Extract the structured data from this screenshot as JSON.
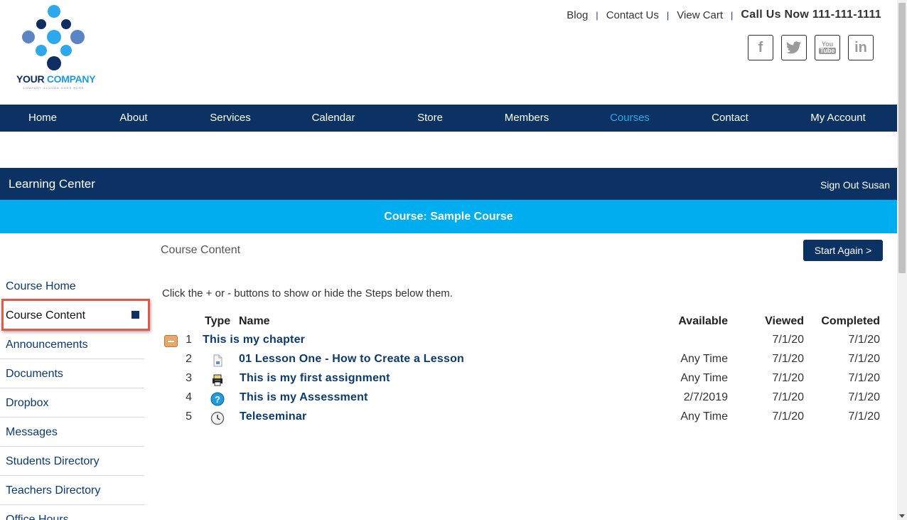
{
  "logo": {
    "text_a": "YOUR ",
    "text_b": "COMPANY",
    "slogan": "COMPANY SLOGAN GOES HERE"
  },
  "toplinks": {
    "blog": "Blog",
    "contact": "Contact Us",
    "cart": "View Cart",
    "call": "Call Us Now 111-111-1111",
    "separator": "|"
  },
  "social": {
    "facebook": "f",
    "twitter": "t",
    "youtube_top": "You",
    "youtube_bottom": "Tube",
    "linkedin": "in"
  },
  "nav": [
    {
      "label": "Home"
    },
    {
      "label": "About"
    },
    {
      "label": "Services"
    },
    {
      "label": "Calendar"
    },
    {
      "label": "Store"
    },
    {
      "label": "Members"
    },
    {
      "label": "Courses",
      "active": true
    },
    {
      "label": "Contact"
    },
    {
      "label": "My Account"
    }
  ],
  "learning_center": {
    "title": "Learning Center",
    "signout": "Sign Out Susan"
  },
  "course_bar": {
    "title": "Course: Sample Course"
  },
  "sidebar": [
    {
      "label": "Course Home"
    },
    {
      "label": "Course Content",
      "active": true
    },
    {
      "label": "Announcements"
    },
    {
      "label": "Documents"
    },
    {
      "label": "Dropbox"
    },
    {
      "label": "Messages"
    },
    {
      "label": "Students Directory"
    },
    {
      "label": "Teachers Directory"
    },
    {
      "label": "Office Hours"
    }
  ],
  "main": {
    "page_label": "Course Content",
    "start_button": "Start Again >",
    "instructions": "Click the + or - buttons to show or hide the Steps below them.",
    "headers": {
      "type": "Type",
      "name": "Name",
      "available": "Available",
      "viewed": "Viewed",
      "completed": "Completed"
    },
    "rows": [
      {
        "num": "1",
        "name": "This is my chapter",
        "available": "",
        "viewed": "7/1/20",
        "completed": "7/1/20",
        "icon": "collapse-icon"
      },
      {
        "num": "2",
        "name": "01 Lesson One - How to Create a Lesson",
        "available": "Any Time",
        "viewed": "7/1/20",
        "completed": "7/1/20",
        "icon": "document-icon"
      },
      {
        "num": "3",
        "name": "This is my first assignment",
        "available": "Any Time",
        "viewed": "7/1/20",
        "completed": "7/1/20",
        "icon": "printer-icon"
      },
      {
        "num": "4",
        "name": "This is my Assessment",
        "available": "2/7/2019",
        "viewed": "7/1/20",
        "completed": "7/1/20",
        "icon": "question-icon"
      },
      {
        "num": "5",
        "name": "Teleseminar",
        "available": "Any Time",
        "viewed": "7/1/20",
        "completed": "7/1/20",
        "icon": "clock-icon"
      }
    ]
  },
  "colors": {
    "navy": "#0b3263",
    "cyan": "#00adef",
    "active_nav": "#29a9e8",
    "highlight": "#e05a47"
  }
}
